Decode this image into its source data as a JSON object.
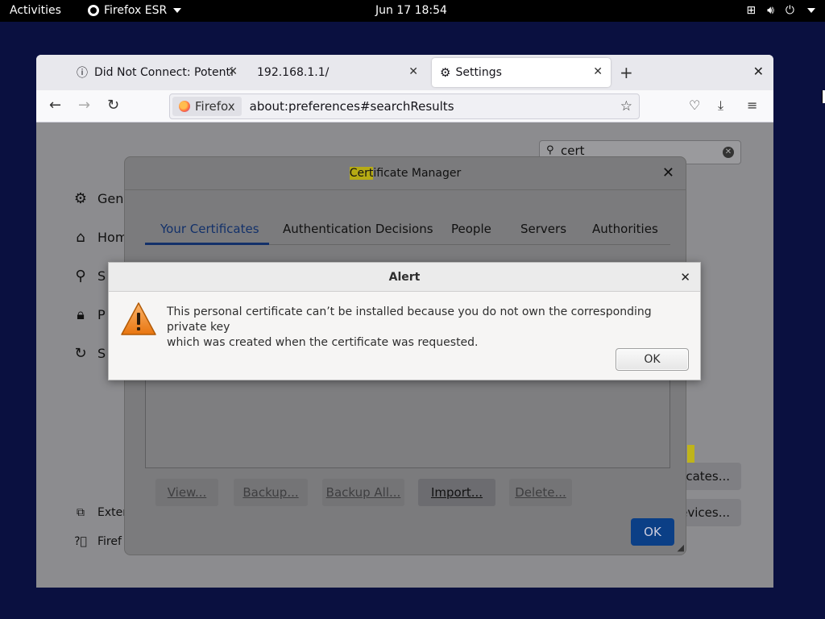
{
  "topbar": {
    "activities": "Activities",
    "app": "Firefox ESR",
    "clock": "Jun 17  18:54"
  },
  "browser": {
    "tabs": [
      {
        "label": "Did Not Connect: Potenti"
      },
      {
        "label": "192.168.1.1/"
      },
      {
        "label": "Settings"
      }
    ],
    "identity": "Firefox",
    "url": "about:preferences#searchResults"
  },
  "settings": {
    "search_value": "cert",
    "sidebar": [
      "Gen",
      "Hom",
      "S",
      "P",
      "S"
    ],
    "footer": [
      "Exter",
      "Firef"
    ],
    "right_buttons": [
      "cates...",
      "evices..."
    ]
  },
  "cert_manager": {
    "title_highlight": "Cert",
    "title_rest": "ificate Manager",
    "tabs": [
      "Your Certificates",
      "Authentication Decisions",
      "People",
      "Servers",
      "Authorities"
    ],
    "buttons": [
      "View...",
      "Backup...",
      "Backup All...",
      "Import...",
      "Delete..."
    ],
    "ok": "OK"
  },
  "alert": {
    "title": "Alert",
    "message_line1": "This personal certificate can’t be installed because you do not own the corresponding private key",
    "message_line2": "which was created when the certificate was requested.",
    "ok": "OK"
  },
  "colors": {
    "desktop": "#0a1040",
    "highlight": "#b6ab14",
    "accent": "#0b3f86"
  }
}
